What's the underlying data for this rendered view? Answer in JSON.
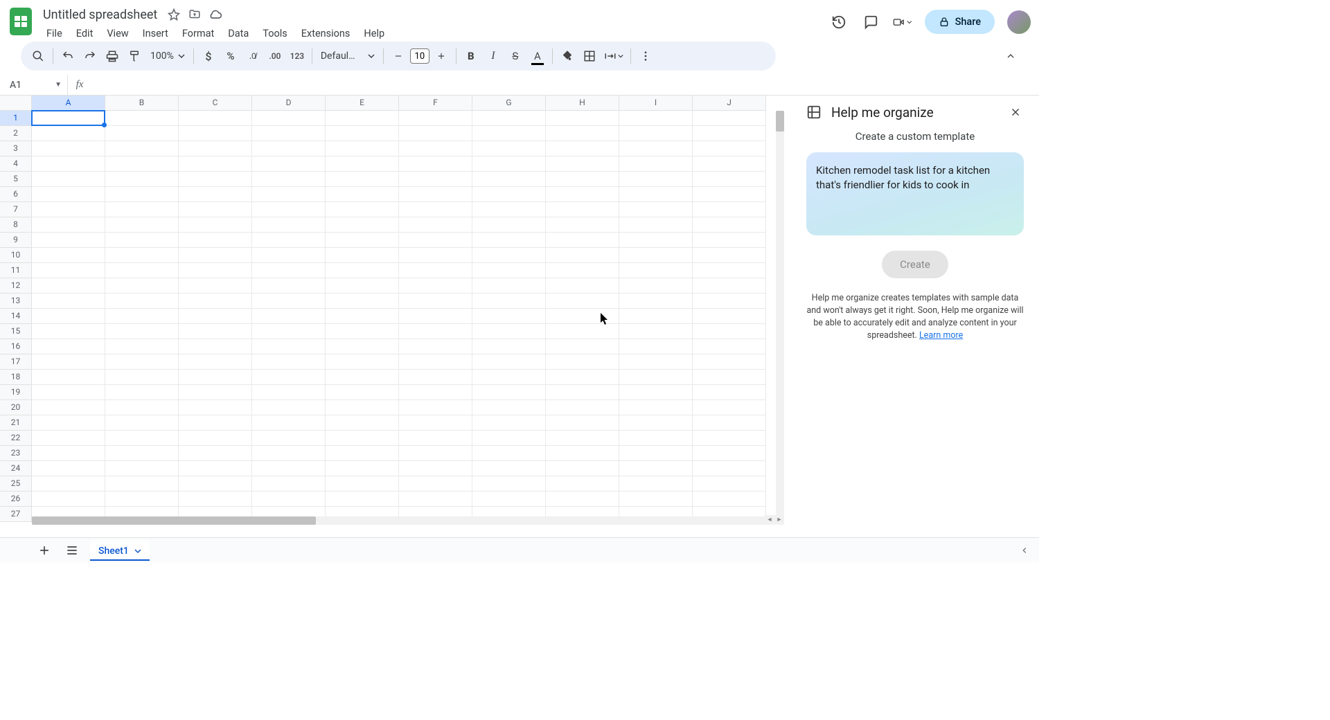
{
  "doc": {
    "title": "Untitled spreadsheet"
  },
  "menu": {
    "items": [
      "File",
      "Edit",
      "View",
      "Insert",
      "Format",
      "Data",
      "Tools",
      "Extensions",
      "Help"
    ]
  },
  "toolbar": {
    "zoom": "100%",
    "font": "Defaul…",
    "font_size": "10",
    "num_format": "123"
  },
  "namebox": {
    "value": "A1"
  },
  "columns": [
    "A",
    "B",
    "C",
    "D",
    "E",
    "F",
    "G",
    "H",
    "I",
    "J"
  ],
  "rows": [
    "1",
    "2",
    "3",
    "4",
    "5",
    "6",
    "7",
    "8",
    "9",
    "10",
    "11",
    "12",
    "13",
    "14",
    "15",
    "16",
    "17",
    "18",
    "19",
    "20",
    "21",
    "22",
    "23",
    "24",
    "25",
    "26",
    "27"
  ],
  "selected": {
    "col": 0,
    "row": 0
  },
  "sidepanel": {
    "title": "Help me organize",
    "subtitle": "Create a custom template",
    "prompt": "Kitchen remodel task list for a kitchen that's friendlier for kids to cook in",
    "create_label": "Create",
    "note_pre": "Help me organize creates templates with sample data and won't always get it right. Soon, Help me organize will be able to accurately edit and analyze content in your spreadsheet. ",
    "learn_more": "Learn more"
  },
  "share": {
    "label": "Share"
  },
  "tabs": {
    "sheet1": "Sheet1"
  }
}
